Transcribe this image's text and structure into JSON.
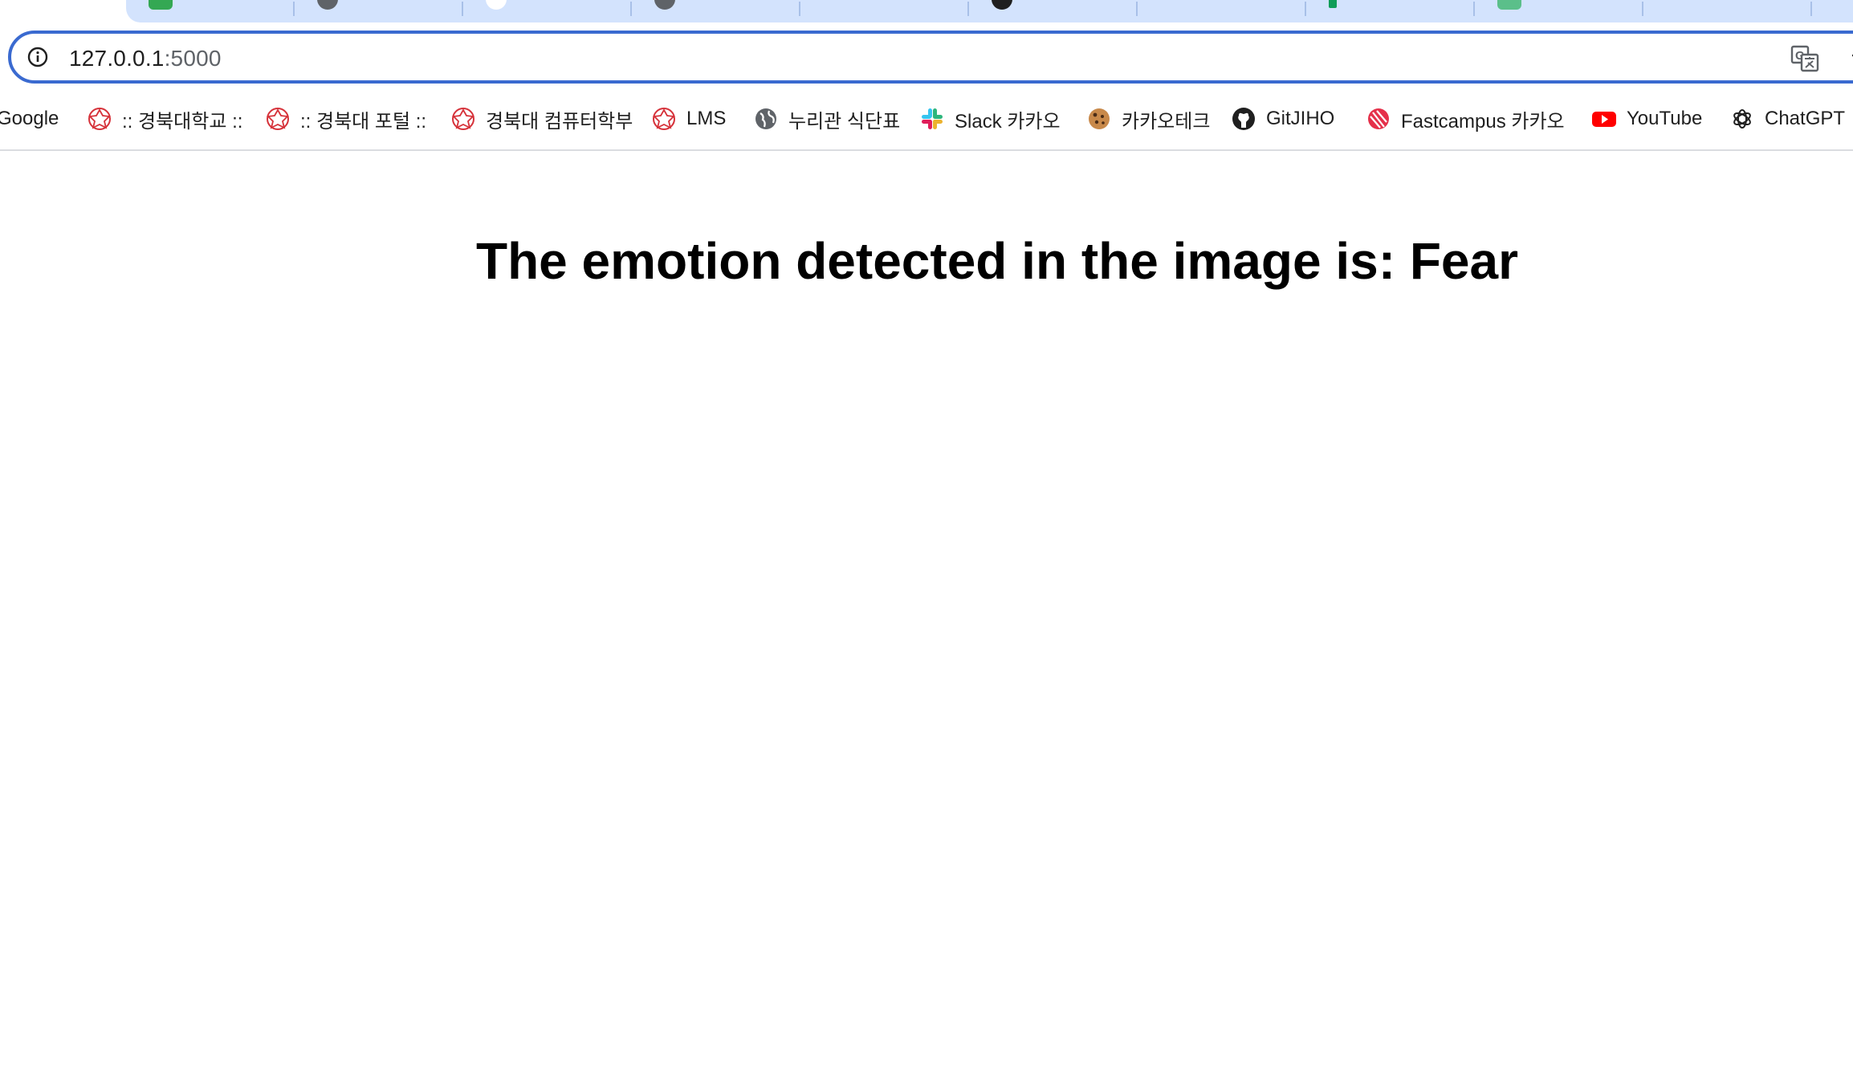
{
  "address_bar": {
    "host": "127.0.0.1",
    "port": ":5000"
  },
  "bookmarks": [
    {
      "label": "Google",
      "icon": "google-icon"
    },
    {
      "label": ":: 경북대학교 ::",
      "icon": "knu-emblem-icon"
    },
    {
      "label": ":: 경북대 포털 ::",
      "icon": "knu-emblem-icon"
    },
    {
      "label": "경북대 컴퓨터학부",
      "icon": "knu-emblem-icon"
    },
    {
      "label": "LMS",
      "icon": "knu-emblem-icon"
    },
    {
      "label": "누리관 식단표",
      "icon": "globe-icon"
    },
    {
      "label": "Slack 카카오",
      "icon": "slack-icon"
    },
    {
      "label": "카카오테크",
      "icon": "cookie-icon"
    },
    {
      "label": "GitJIHO",
      "icon": "github-icon"
    },
    {
      "label": "Fastcampus 카카오",
      "icon": "fastcampus-icon"
    },
    {
      "label": "YouTube",
      "icon": "youtube-icon"
    },
    {
      "label": "ChatGPT",
      "icon": "chatgpt-icon"
    }
  ],
  "page": {
    "heading": "The emotion detected in the image is: Fear"
  },
  "colors": {
    "tabstrip": "#d3e3fd",
    "omnibox_border": "#3a6ad0",
    "knu_red": "#d6323a",
    "youtube_red": "#ff0000"
  }
}
